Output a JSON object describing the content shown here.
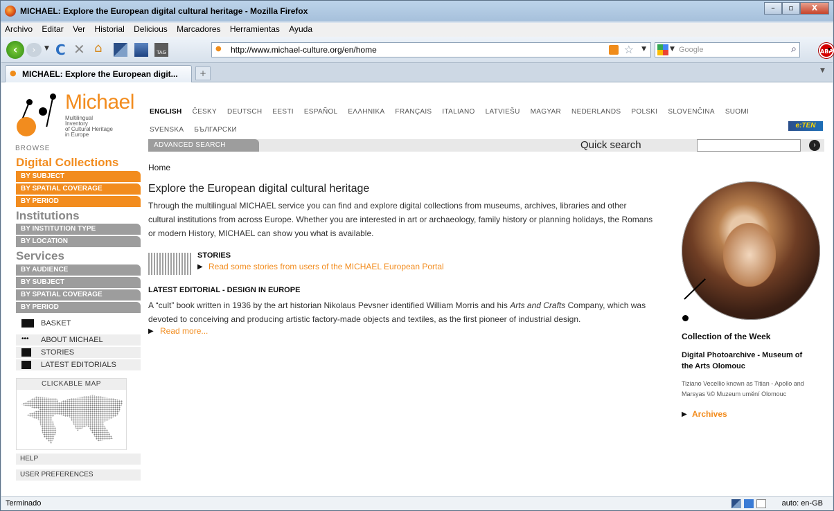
{
  "window": {
    "title": "MICHAEL: Explore the European digital cultural heritage - Mozilla Firefox",
    "controls": [
      "–",
      "▫",
      "X"
    ]
  },
  "menubar": [
    "Archivo",
    "Editar",
    "Ver",
    "Historial",
    "Delicious",
    "Marcadores",
    "Herramientas",
    "Ayuda"
  ],
  "toolbar": {
    "url": "http://www.michael-culture.org/en/home",
    "search_placeholder": "Google",
    "tag_label": "TAG",
    "abp_label": "ABP"
  },
  "tab": {
    "label": "MICHAEL: Explore the European digit...",
    "new_tab": "+"
  },
  "logo": {
    "word": "Michael",
    "tagline": [
      "Multilingual",
      "Inventory",
      "of Cultural Heritage",
      "in Europe"
    ]
  },
  "sidebar": {
    "browse": "BROWSE",
    "digital_collections": {
      "title": "Digital Collections",
      "items": [
        "BY SUBJECT",
        "BY SPATIAL COVERAGE",
        "BY PERIOD"
      ]
    },
    "institutions": {
      "title": "Institutions",
      "items": [
        "BY INSTITUTION TYPE",
        "BY LOCATION"
      ]
    },
    "services": {
      "title": "Services",
      "items": [
        "BY AUDIENCE",
        "BY SUBJECT",
        "BY SPATIAL COVERAGE",
        "BY PERIOD"
      ]
    },
    "basket": "BASKET",
    "links": [
      "ABOUT MICHAEL",
      "STORIES",
      "LATEST EDITORIALS"
    ],
    "map_title": "CLICKABLE MAP",
    "help": "HELP",
    "user_prefs": "USER PREFERENCES"
  },
  "languages": {
    "row1": [
      "ENGLISH",
      "ČESKY",
      "DEUTSCH",
      "EESTI",
      "ESPAÑOL",
      "ΕΛΛΗΝΙΚΑ",
      "FRANÇAIS",
      "ITALIANO",
      "LATVIEŠU",
      "MAGYAR",
      "NEDERLANDS",
      "POLSKI",
      "SLOVENČINA",
      "SUOMI"
    ],
    "row2": [
      "SVENSKA",
      "БЪЛГАРСКИ"
    ],
    "active": "ENGLISH"
  },
  "eten": "e:TEN",
  "search": {
    "advanced": "ADVANCED SEARCH",
    "quick": "Quick search",
    "go": "›"
  },
  "main": {
    "breadcrumb": "Home",
    "heading": "Explore the European digital cultural heritage",
    "intro": "Through the multilingual MICHAEL service you can find and explore digital collections from museums, archives, libraries and other cultural institutions from across Europe. Whether you are interested in art or archaeology, family history or planning holidays, the Romans or modern History, MICHAEL can show you what is available.",
    "stories_title": "STORIES",
    "stories_link": "Read some stories from users of the MICHAEL European Portal",
    "editorial_title": "LATEST EDITORIAL - DESIGN IN EUROPE",
    "editorial_text_1": "A “cult” book written in 1936 by the art historian Nikolaus Pevsner identified William Morris and his ",
    "editorial_text_em": "Arts and Crafts",
    "editorial_text_2": " Company, which was devoted to conceiving and producing artistic factory-made objects and textiles, as the first pioneer of industrial design.",
    "read_more": "Read more..."
  },
  "cotw": {
    "title": "Collection of the Week",
    "name": "Digital Photoarchive - Museum of the Arts Olomouc",
    "caption": "Tiziano Vecellio known as Titian - Apollo and Marsyas \\\\© Muzeum umění Olomouc",
    "archives": "Archives"
  },
  "status": {
    "left": "Terminado",
    "right": "auto: en-GB"
  },
  "colors": {
    "accent": "#f28c1e",
    "gray_button": "#9d9d9d"
  }
}
